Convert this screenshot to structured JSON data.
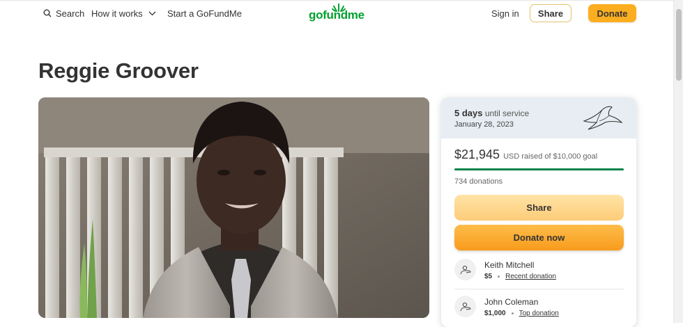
{
  "header": {
    "search_label": "Search",
    "how_label": "How it works",
    "start_label": "Start a GoFundMe",
    "logo_text": "gofundme",
    "signin_label": "Sign in",
    "share_label": "Share",
    "donate_label": "Donate"
  },
  "campaign": {
    "title": "Reggie Groover"
  },
  "card": {
    "days_value": "5 days",
    "days_suffix": "until service",
    "service_date": "January 28, 2023",
    "amount": "$21,945",
    "goal_text": "USD raised of $10,000 goal",
    "progress_fraction": 1.0,
    "donations_count": "734 donations",
    "share_label": "Share",
    "donate_label": "Donate now"
  },
  "donors": [
    {
      "name": "Keith Mitchell",
      "amount": "$5",
      "tag": "Recent donation"
    },
    {
      "name": "John Coleman",
      "amount": "$1,000",
      "tag": "Top donation"
    }
  ],
  "colors": {
    "brand_green": "#01a02e",
    "donate_orange": "#fcae21",
    "progress_green": "#01844a"
  }
}
